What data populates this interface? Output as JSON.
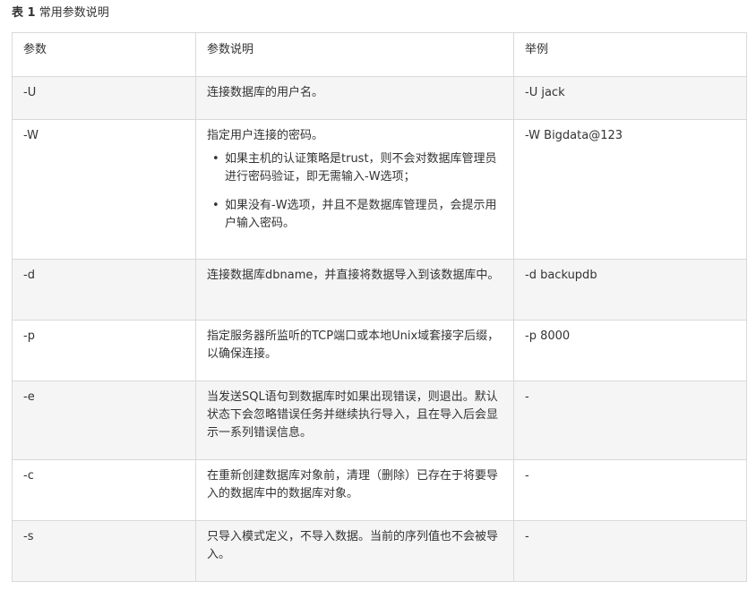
{
  "caption": {
    "prefix": "表 1",
    "text": "常用参数说明"
  },
  "table": {
    "headers": {
      "param": "参数",
      "description": "参数说明",
      "example": "举例"
    },
    "rows": [
      {
        "param": "-U",
        "description": "连接数据库的用户名。",
        "example": "-U jack"
      },
      {
        "param": "-W",
        "description": "指定用户连接的密码。",
        "bullets": [
          "如果主机的认证策略是trust，则不会对数据库管理员进行密码验证，即无需输入-W选项；",
          "如果没有-W选项，并且不是数据库管理员，会提示用户输入密码。"
        ],
        "example": "-W Bigdata@123"
      },
      {
        "param": "-d",
        "description": "连接数据库dbname，并直接将数据导入到该数据库中。",
        "example": "-d backupdb"
      },
      {
        "param": "-p",
        "description": "指定服务器所监听的TCP端口或本地Unix域套接字后缀，以确保连接。",
        "example": "-p 8000"
      },
      {
        "param": "-e",
        "description": "当发送SQL语句到数据库时如果出现错误，则退出。默认状态下会忽略错误任务并继续执行导入，且在导入后会显示一系列错误信息。",
        "example": "-"
      },
      {
        "param": "-c",
        "description": "在重新创建数据库对象前，清理（删除）已存在于将要导入的数据库中的数据库对象。",
        "example": "-"
      },
      {
        "param": "-s",
        "description": "只导入模式定义，不导入数据。当前的序列值也不会被导入。",
        "example": "-"
      }
    ]
  }
}
